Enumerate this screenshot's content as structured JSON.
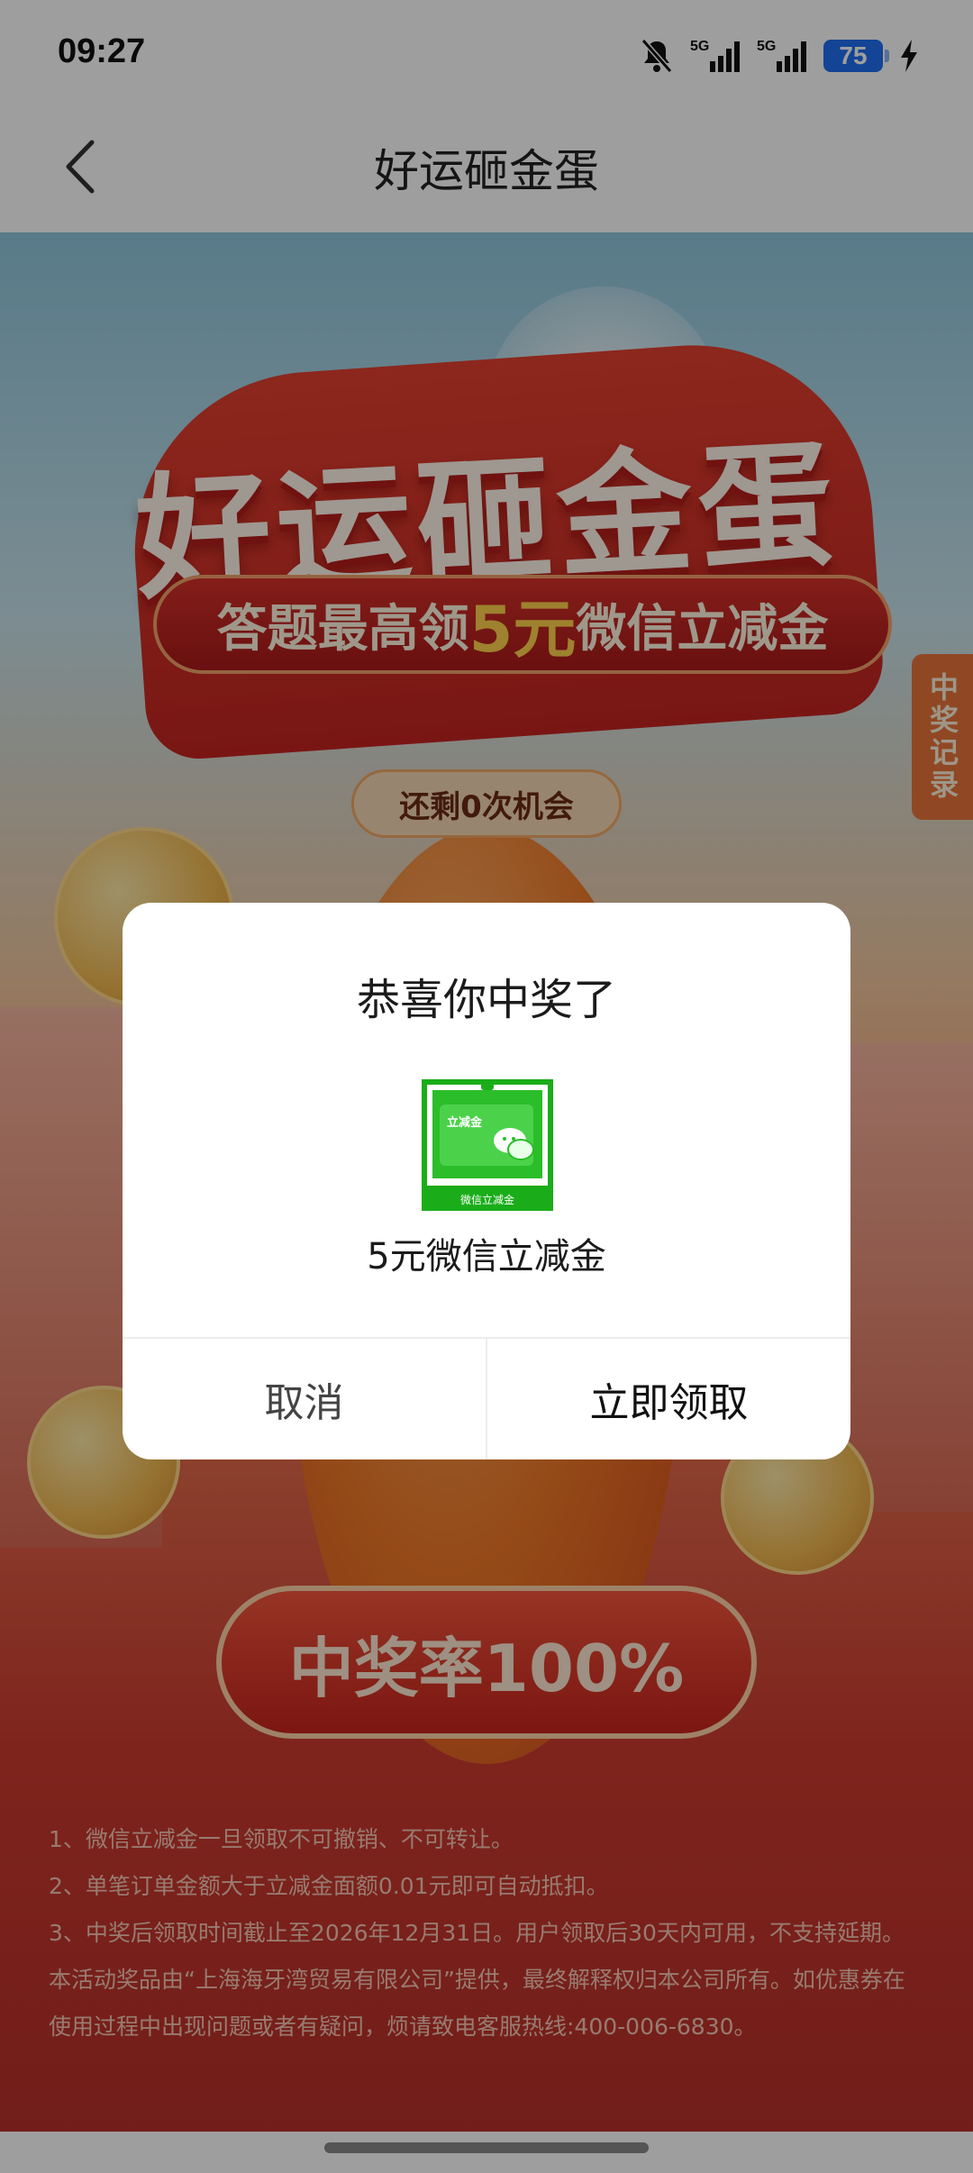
{
  "status_bar": {
    "time": "09:27",
    "network_1": "5G",
    "network_2": "5G",
    "battery": "75"
  },
  "nav": {
    "title": "好运砸金蛋"
  },
  "banner": {
    "title": "好运砸金蛋",
    "subtitle_prefix": "答题最高领",
    "subtitle_highlight": "5元",
    "subtitle_suffix": "微信立减金",
    "chances": "还剩0次机会"
  },
  "record_tab": "中奖记录",
  "rate_button": "中奖率100%",
  "rules": [
    "1、微信立减金一旦领取不可撤销、不可转让。",
    "2、单笔订单金额大于立减金面额0.01元即可自动抵扣。",
    "3、中奖后领取时间截止至2026年12月31日。用户领取后30天内可用，不支持延期。",
    "本活动奖品由“上海海牙湾贸易有限公司”提供，最终解释权归本公司所有。如优惠券在",
    "使用过程中出现问题或者有疑问，烦请致电客服热线:400-006-6830。"
  ],
  "dialog": {
    "title": "恭喜你中奖了",
    "voucher_tag": "立减金",
    "voucher_caption": "微信立减金",
    "prize": "5元微信立减金",
    "cancel": "取消",
    "confirm": "立即领取"
  },
  "colors": {
    "accent_red": "#c7241d",
    "wechat_green": "#1aad19",
    "battery_blue": "#1f6ff2"
  }
}
